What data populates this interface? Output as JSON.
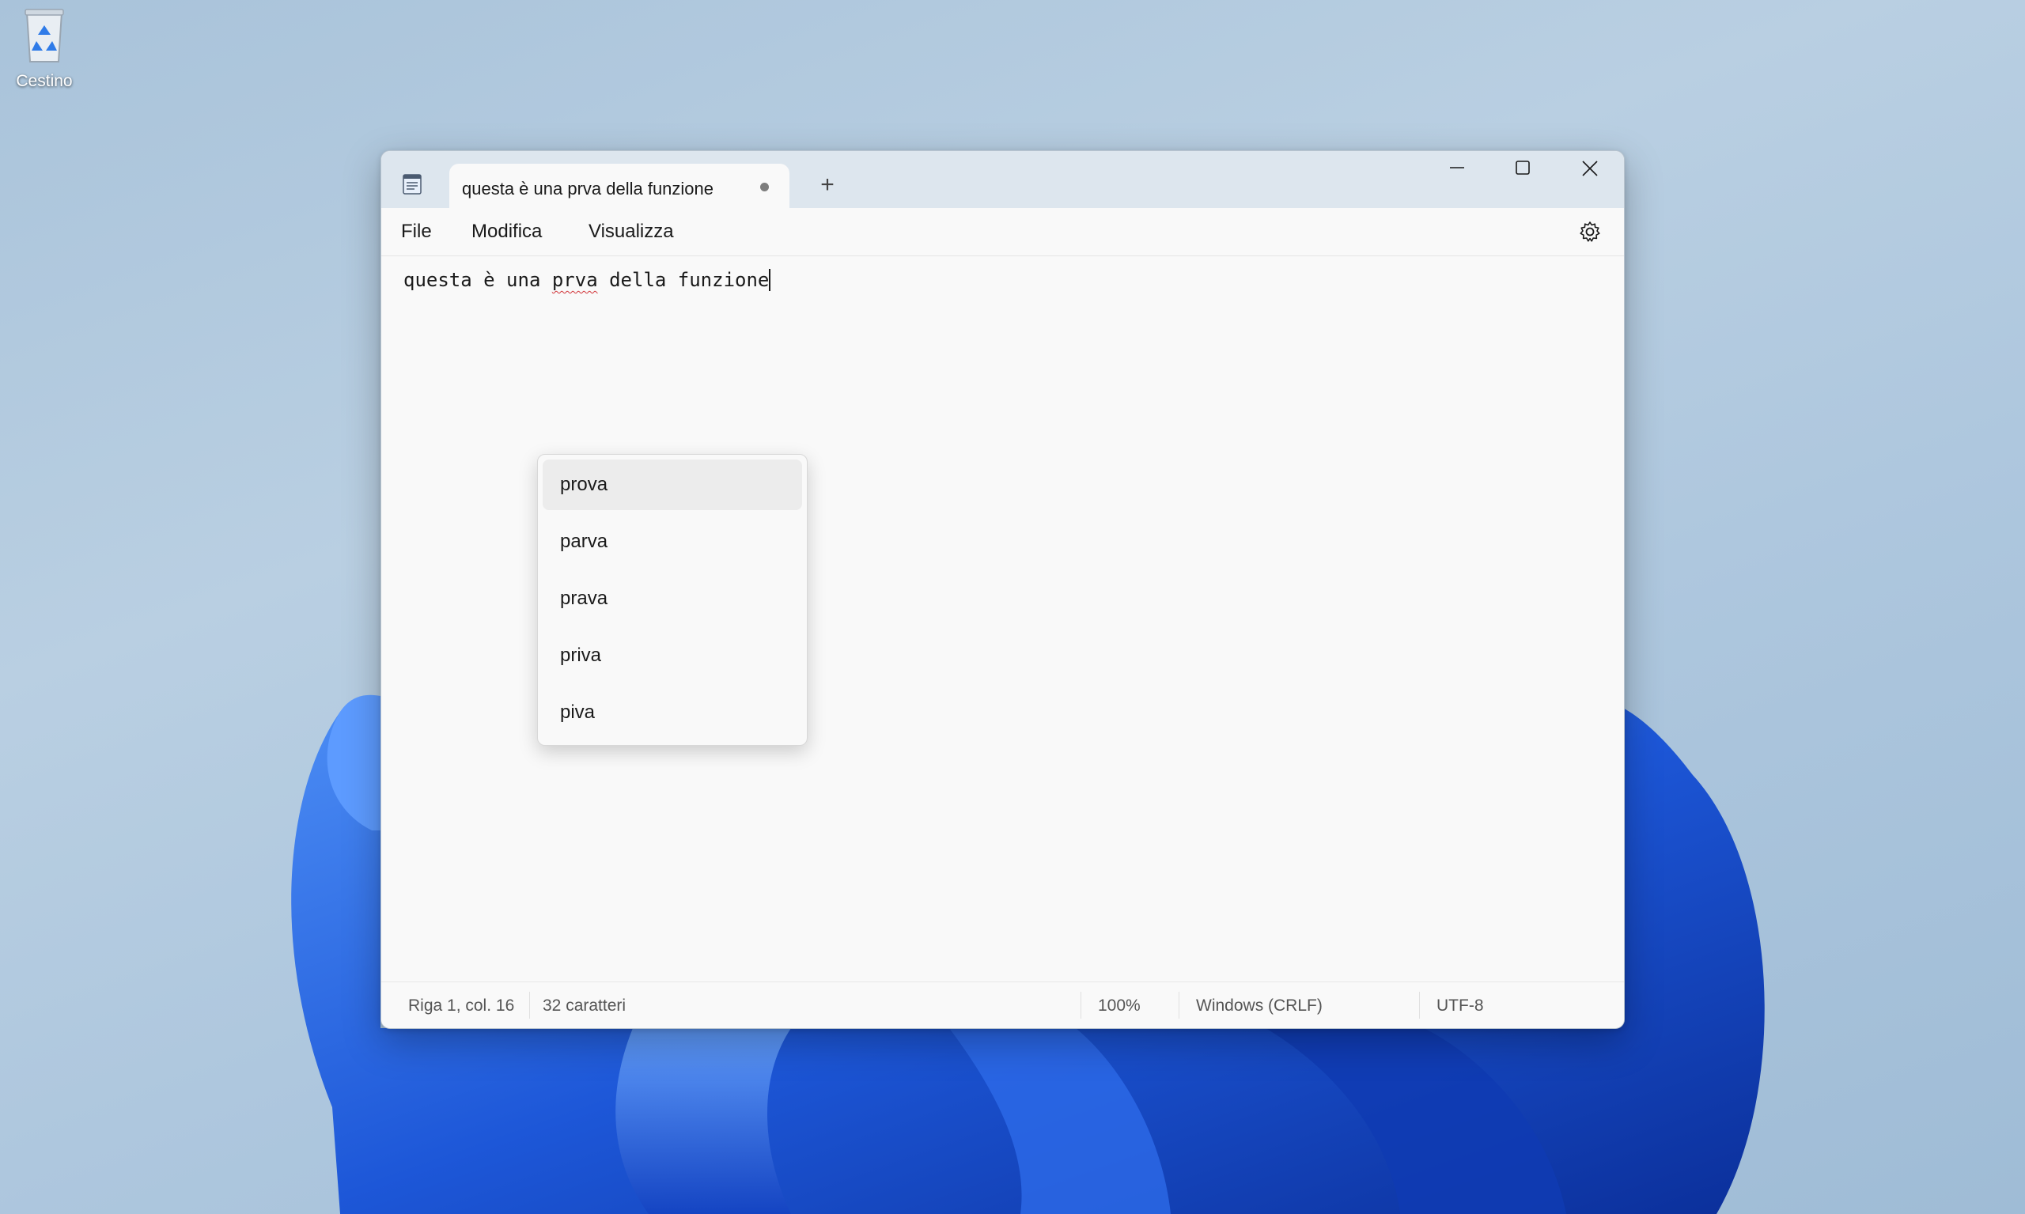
{
  "desktop": {
    "recycle_bin_label": "Cestino"
  },
  "window": {
    "tab_title": "questa è una prva della funzione",
    "new_tab_label": "+",
    "menu": {
      "file": "File",
      "edit": "Modifica",
      "view": "Visualizza"
    }
  },
  "editor": {
    "text_before": "questa è una ",
    "misspelled_word": "prva",
    "text_after": " della funzione"
  },
  "suggestions": [
    "prova",
    "parva",
    "prava",
    "priva",
    "piva"
  ],
  "status": {
    "position": "Riga 1, col. 16",
    "characters": "32 caratteri",
    "zoom": "100%",
    "line_ending": "Windows (CRLF)",
    "encoding": "UTF-8"
  },
  "colors": {
    "accent_bloom": "#1f5fd6",
    "titlebar": "#dde6ee",
    "spell_underline": "#d13438"
  }
}
